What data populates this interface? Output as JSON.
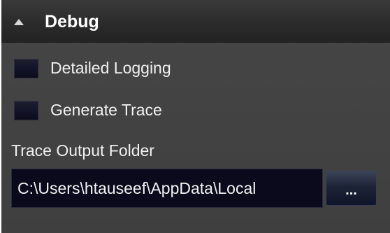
{
  "section": {
    "title": "Debug"
  },
  "options": {
    "detailed_logging_label": "Detailed Logging",
    "detailed_logging_checked": false,
    "generate_trace_label": "Generate Trace",
    "generate_trace_checked": false
  },
  "trace_output": {
    "label": "Trace Output Folder",
    "value": "C:\\Users\\htauseef\\AppData\\Local",
    "browse_label": "..."
  },
  "colors": {
    "panel_background": "#434343",
    "header_background": "#2b2b2b",
    "input_background": "#0a0a1c",
    "text": "#f0f0f0"
  },
  "icons": {
    "collapse": "chevron-up-icon"
  }
}
